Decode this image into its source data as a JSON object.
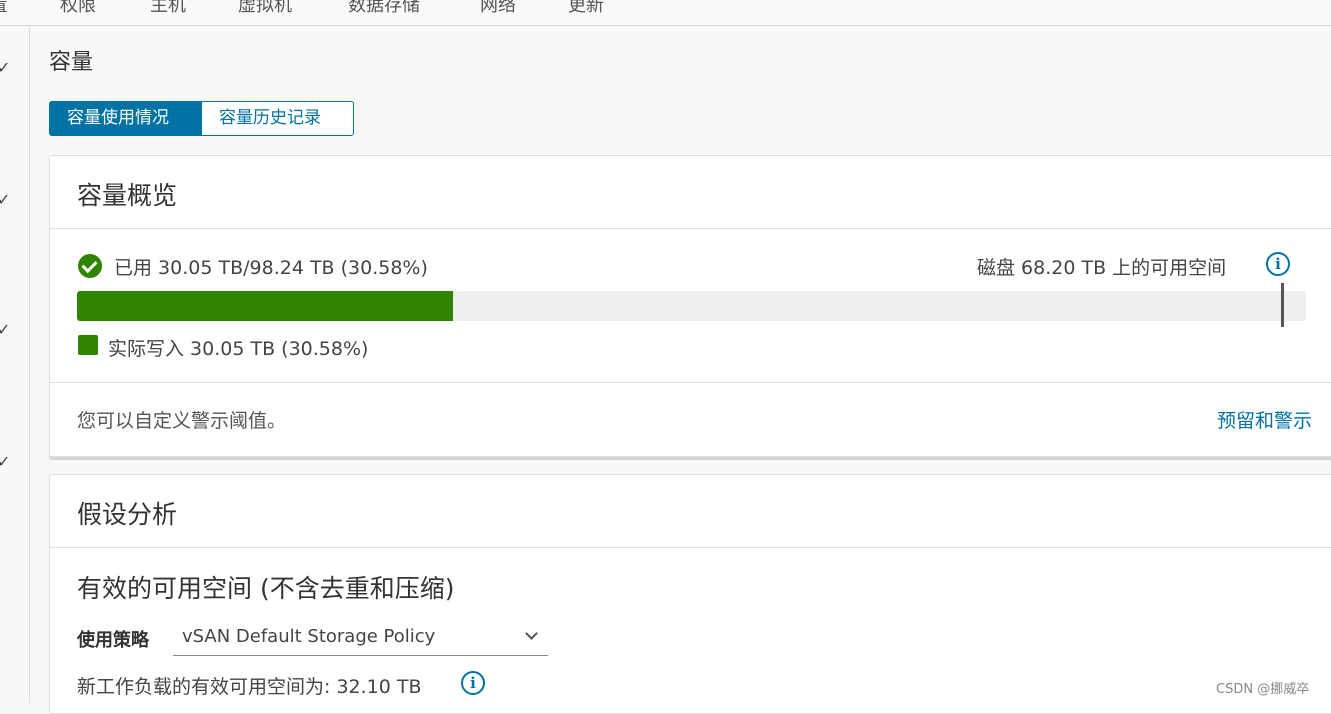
{
  "topnav": {
    "items": [
      "置",
      "权限",
      "主机",
      "虚拟机",
      "数据存储",
      "网络",
      "更新"
    ]
  },
  "page": {
    "title": "容量"
  },
  "tabs": [
    {
      "label": "容量使用情况",
      "active": true
    },
    {
      "label": "容量历史记录",
      "active": false
    }
  ],
  "overview": {
    "title": "容量概览",
    "used_text": "已用 30.05 TB/98.24 TB (30.58%)",
    "used_fraction": 0.3058,
    "free_text": "磁盘 68.20 TB 上的可用空间",
    "legend_text": "实际写入 30.05 TB (30.58%)",
    "hint_text": "您可以自定义警示阈值。",
    "link_text": "预留和警示",
    "colors": {
      "used": "#2f8400",
      "track": "#eeeeee",
      "accent": "#0072a3"
    },
    "icons": {
      "status": "check-circle-icon",
      "info": "info-icon"
    }
  },
  "whatif": {
    "title": "假设分析",
    "section_title": "有效的可用空间 (不含去重和压缩)",
    "policy_label": "使用策略",
    "policy_value": "vSAN Default Storage Policy",
    "effective_text": "新工作负载的有效可用空间为: 32.10 TB"
  },
  "watermark": "CSDN @挪威卒"
}
